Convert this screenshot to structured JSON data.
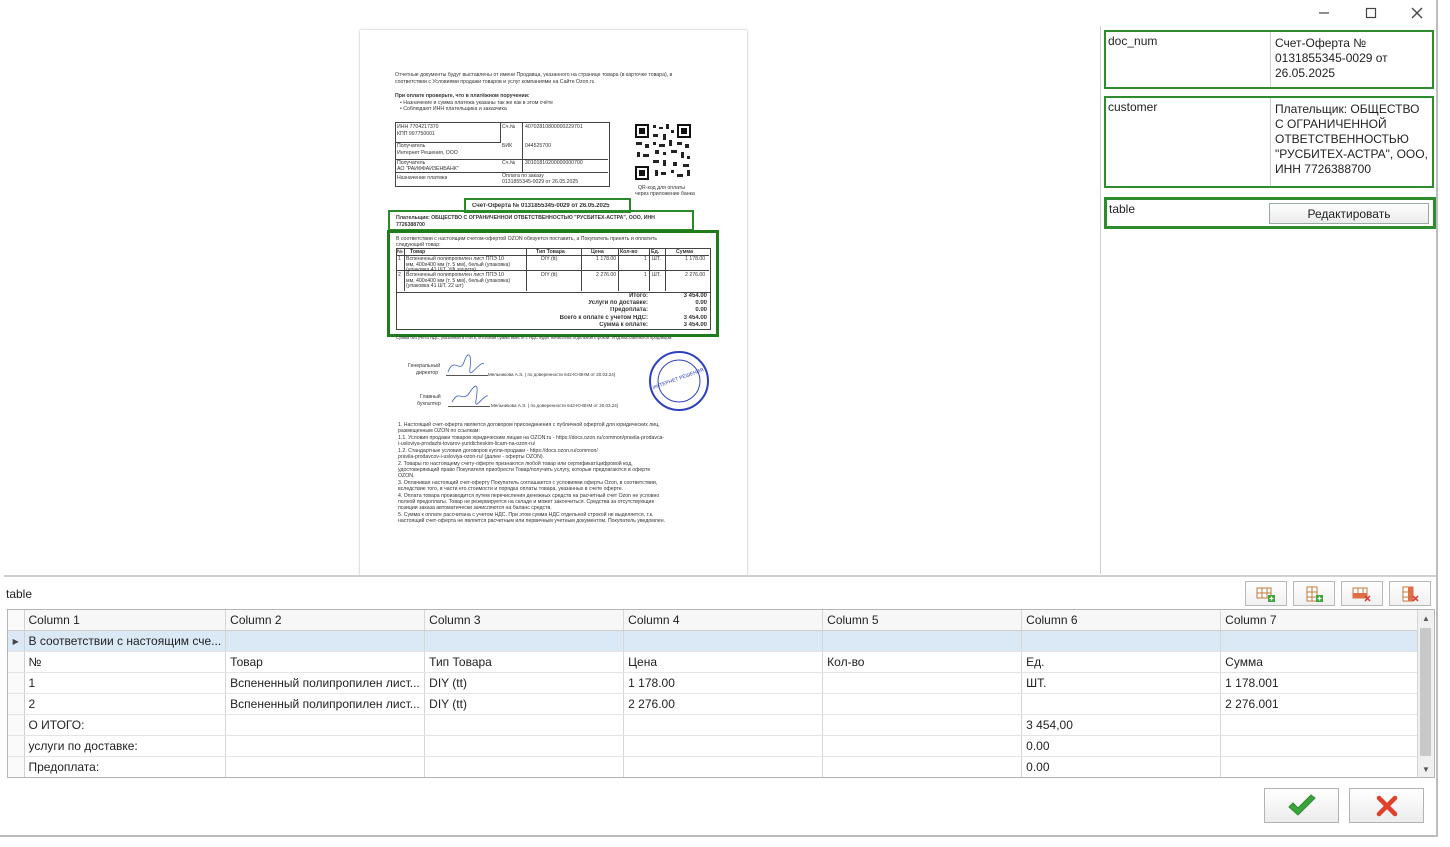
{
  "window": {
    "minimize": "—",
    "maximize": "☐",
    "close": "✕"
  },
  "document": {
    "lines": [
      "Отчетные документы будут выставлены от имени Продавца, указанного на странице товара (в карточке товара), в",
      "соответствии с Условиями продажи товаров и услуг компаниями на Сайте Ozon.ru",
      "При оплате проверьте, что в платёжном поручении:",
      "• Назначение и сумма платежа указаны так же как в этом счёте",
      "• Соблюдают ИНН плательщика и заказчика"
    ],
    "bank": {
      "inn": "ИНН 7704217370",
      "kpp": "КПП 997750001",
      "acc_label": "Сч.№",
      "acc": "40702810800000229701",
      "recipient_label": "Получатель",
      "recipient": "Интернет Решения, ООО",
      "bik_label": "БИК",
      "bik": "044525700",
      "bank_label": "Получатель",
      "bank": "АО \"РАЙФФАЙЗЕНБАНК\"",
      "corr_label": "Сч.№",
      "corr": "30101810200000000700",
      "purpose_label": "Назначение платежа",
      "purpose1": "Оплата по заказу",
      "purpose2": "0131855345-0029 от 26.05.2025",
      "qr_caption1": "QR-код для оплаты",
      "qr_caption2": "через приложение банка"
    },
    "title": "Счет-Оферта № 0131855345-0029 от 26.05.2025",
    "payer": "Плательщик: ОБЩЕСТВО С ОГРАНИЧЕННОЙ ОТВЕТСТВЕННОСТЬЮ \"РУСБИТЕХ-АСТРА\", ООО, ИНН",
    "payer2": "7726388700",
    "intro": "В соответствии с настоящим счетом-офертой OZON обязуется поставить, а Покупатель принять и оплатить",
    "intro2": "следующий товар:",
    "cols": [
      "№",
      "Товар",
      "Тип Товара",
      "Цена",
      "Кол-во",
      "Ед.",
      "Сумма"
    ],
    "r1": [
      "1",
      "Вспененный полипропилен лист ППЭ 10",
      "мм, 400х400 мм (т. 5 мм), белый (упаковка)",
      "(упаковка 41 ШТ. УФ защита)",
      "DIY (tt)",
      "1 178.00",
      "1",
      "ШТ.",
      "1 178.00"
    ],
    "r2": [
      "2",
      "Вспененный полипропилен лист ППЭ 10",
      "мм, 400х400 мм (т. 5 мм), белый (упаковка)",
      "(упаковка 41 ШТ. 22 шт)",
      "DIY (tt)",
      "2 276.00",
      "1",
      "ШТ.",
      "2 276.00"
    ],
    "totals": [
      [
        "Итого:",
        "3 454.00"
      ],
      [
        "Услуги по доставке:",
        "0.00"
      ],
      [
        "Предоплата:",
        "0.00"
      ],
      [
        "Всего к оплате с учетом НДС:",
        "3 454.00"
      ],
      [
        "Сумма к оплате:",
        "3 454.00"
      ]
    ],
    "vat_note": "Сумма без учета НДС, указанная в счёте, Итоговая сумма вместе с НДС будет начислена отдельной строкой. УПД выставляются продавцом.",
    "sign1a": "Генеральный",
    "sign1b": "директор",
    "sign1c": "Мельникова А.Э. ( по доверенности 642-Ю-ВНМ от 20.03.24)",
    "sign2a": "Главный",
    "sign2b": "бухгалтер",
    "sign2c": "Мельникова А.Э. ( по доверенности 642-Ю-ВНМ от 20.03.24)",
    "terms": [
      "1.   Настоящий счет-оферта является договором присоединения с публичной офертой для юридических лиц,",
      "      размещенным OZON по ссылкам:",
      "1.1. Условия продажи товаров юридическим лицам на OZON.ru - https://docs.ozon.ru/common/pravila-prodavca-",
      "      i-usloviya-prodazhi-tovarov-yuridicheskim-licam-na-ozon-ru/",
      "1.2. Стандартные условия договоров купли-продажи - https://docs.ozon.ru/common/",
      "      pravila-prodavcov-i-usloviya-ozon-ru/ (далее - оферты OZON).",
      "2.   Товары по настоящему счету-оферте признаются любой товар или сертификат/цифровой код,",
      "      удостоверяющий право Покупателя приобрести Товар/получить услугу, которые предлагаются в оферте",
      "      OZON.",
      "3.   Оплачивая настоящий счет-оферту Покупатель соглашается с условиями оферты Ozon, в соответствии,",
      "      вследствие того, в части его стоимости и порядка оплаты товара, указанных в счете оферте.",
      "4.   Оплата товара производится путем перечисления денежных средств на расчетный счет Ozon не условно",
      "      полной предоплаты. Товар не резервируется на складе и может закончиться. Средства за отсутствующие",
      "      позиции заказа автоматически зачисляются на баланс средств.",
      "5.   Сумма к оплате рассчитана с учетом НДС. При этом сумма НДС отдельной строкой не выделяется, т.к.",
      "      настоящий счет-оферта не является расчетным или первичным учетным документом. Покупатель уведомлен."
    ],
    "stamp": "ИНТЕРНЕТ РЕШЕНИЯ"
  },
  "fields": [
    {
      "label": "doc_num",
      "value": "Счет-Оферта № 0131855345-0029 от 26.05.2025"
    },
    {
      "label": "customer",
      "value": "Плательщик: ОБЩЕСТВО С ОГРАНИЧЕННОЙ ОТВЕТСТВЕННОСТЬЮ \"РУСБИТЕХ-АСТРА\", ООО, ИНН 7726388700"
    },
    {
      "label": "table",
      "button": "Редактировать"
    }
  ],
  "table_section": {
    "label": "table",
    "columns": [
      "Column 1",
      "Column 2",
      "Column 3",
      "Column 4",
      "Column 5",
      "Column 6",
      "Column 7"
    ],
    "rows": [
      [
        "В соответствии с настоящим сче...",
        "",
        "",
        "",
        "",
        "",
        ""
      ],
      [
        "№",
        "Товар",
        "Тип Товара",
        "Цена",
        "Кол-во",
        "Ед.",
        "Сумма"
      ],
      [
        "1",
        "Вспененный полипропилен лист...",
        "DIY (tt)",
        "1 178.00",
        "",
        "ШТ.",
        "1 178.001"
      ],
      [
        "2",
        "Вспененный полипропилен лист...",
        "DIY (tt)",
        "2 276.00",
        "",
        "",
        "2 276.001"
      ],
      [
        "О ИТОГО:",
        "",
        "",
        "",
        "",
        "3 454,00",
        ""
      ],
      [
        "услуги по доставке:",
        "",
        "",
        "",
        "",
        "0.00",
        ""
      ],
      [
        "Предоплата:",
        "",
        "",
        "",
        "",
        "0.00",
        ""
      ]
    ],
    "selected_row_marker": "▶"
  },
  "colors": {
    "highlight": "#2e8b2e",
    "ok": "#3aa53a",
    "cancel": "#e0402a",
    "selected_row": "#dbe9f7"
  }
}
